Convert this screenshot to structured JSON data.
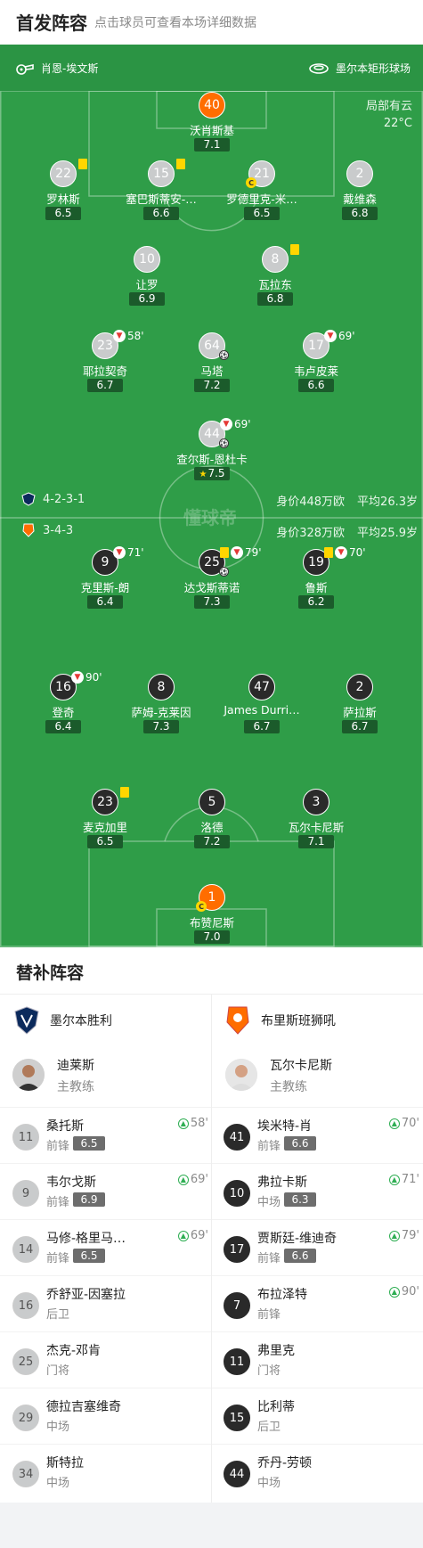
{
  "header": {
    "title": "首发阵容",
    "hint": "点击球员可查看本场详细数据"
  },
  "pitch_info": {
    "referee": "肖恩-埃文斯",
    "stadium": "墨尔本矩形球场",
    "weather": "局部有云",
    "temperature": "22°C"
  },
  "home": {
    "formation": "4-2-3-1",
    "market_value": "身价448万欧",
    "avg_age": "平均26.3岁",
    "players": [
      {
        "num": "40",
        "name": "沃肖斯基",
        "rating": "7.1"
      },
      {
        "num": "22",
        "name": "罗林斯",
        "rating": "6.5"
      },
      {
        "num": "15",
        "name": "塞巴斯蒂安-…",
        "rating": "6.6"
      },
      {
        "num": "21",
        "name": "罗德里克-米…",
        "rating": "6.5"
      },
      {
        "num": "2",
        "name": "戴维森",
        "rating": "6.8"
      },
      {
        "num": "10",
        "name": "让罗",
        "rating": "6.9"
      },
      {
        "num": "8",
        "name": "瓦拉东",
        "rating": "6.8"
      },
      {
        "num": "23",
        "name": "耶拉契奇",
        "rating": "6.7",
        "sub": "58'"
      },
      {
        "num": "64",
        "name": "马塔",
        "rating": "7.2"
      },
      {
        "num": "17",
        "name": "韦卢皮莱",
        "rating": "6.6",
        "sub": "69'"
      },
      {
        "num": "44",
        "name": "查尔斯-恩杜卡",
        "rating": "7.5",
        "sub": "69'"
      }
    ]
  },
  "away": {
    "formation": "3-4-3",
    "market_value": "身价328万欧",
    "avg_age": "平均25.9岁",
    "players": [
      {
        "num": "9",
        "name": "克里斯-朗",
        "rating": "6.4",
        "sub": "71'"
      },
      {
        "num": "25",
        "name": "达戈斯蒂诺",
        "rating": "7.3",
        "sub": "79'"
      },
      {
        "num": "19",
        "name": "鲁斯",
        "rating": "6.2",
        "sub": "70'"
      },
      {
        "num": "16",
        "name": "登奇",
        "rating": "6.4",
        "sub": "90'"
      },
      {
        "num": "8",
        "name": "萨姆-克莱因",
        "rating": "7.3"
      },
      {
        "num": "47",
        "name": "James Durri…",
        "rating": "6.7"
      },
      {
        "num": "2",
        "name": "萨拉斯",
        "rating": "6.7"
      },
      {
        "num": "23",
        "name": "麦克加里",
        "rating": "6.5"
      },
      {
        "num": "5",
        "name": "洛德",
        "rating": "7.2"
      },
      {
        "num": "3",
        "name": "瓦尔卡尼斯",
        "rating": "7.1"
      },
      {
        "num": "1",
        "name": "布赞尼斯",
        "rating": "7.0"
      }
    ]
  },
  "watermark": "懂球帝",
  "subs": {
    "title": "替补阵容",
    "home_team": "墨尔本胜利",
    "away_team": "布里斯班狮吼",
    "home_coach": {
      "name": "迪莱斯",
      "role": "主教练"
    },
    "away_coach": {
      "name": "瓦尔卡尼斯",
      "role": "主教练"
    },
    "home_list": [
      {
        "num": "11",
        "name": "桑托斯",
        "pos": "前锋",
        "rating": "6.5",
        "in": "58'"
      },
      {
        "num": "9",
        "name": "韦尔戈斯",
        "pos": "前锋",
        "rating": "6.9",
        "in": "69'"
      },
      {
        "num": "14",
        "name": "马修-格里马…",
        "pos": "前锋",
        "rating": "6.5",
        "in": "69'"
      },
      {
        "num": "16",
        "name": "乔舒亚-因塞拉",
        "pos": "后卫"
      },
      {
        "num": "25",
        "name": "杰克-邓肯",
        "pos": "门将"
      },
      {
        "num": "29",
        "name": "德拉吉塞维奇",
        "pos": "中场"
      },
      {
        "num": "34",
        "name": "斯特拉",
        "pos": "中场"
      }
    ],
    "away_list": [
      {
        "num": "41",
        "name": "埃米特-肖",
        "pos": "前锋",
        "rating": "6.6",
        "in": "70'"
      },
      {
        "num": "10",
        "name": "弗拉卡斯",
        "pos": "中场",
        "rating": "6.3",
        "in": "71'"
      },
      {
        "num": "17",
        "name": "贾斯廷-维迪奇",
        "pos": "前锋",
        "rating": "6.6",
        "in": "79'"
      },
      {
        "num": "7",
        "name": "布拉泽特",
        "pos": "前锋",
        "in": "90'"
      },
      {
        "num": "11",
        "name": "弗里克",
        "pos": "门将"
      },
      {
        "num": "15",
        "name": "比利蒂",
        "pos": "后卫"
      },
      {
        "num": "44",
        "name": "乔丹-劳顿",
        "pos": "中场"
      }
    ]
  }
}
